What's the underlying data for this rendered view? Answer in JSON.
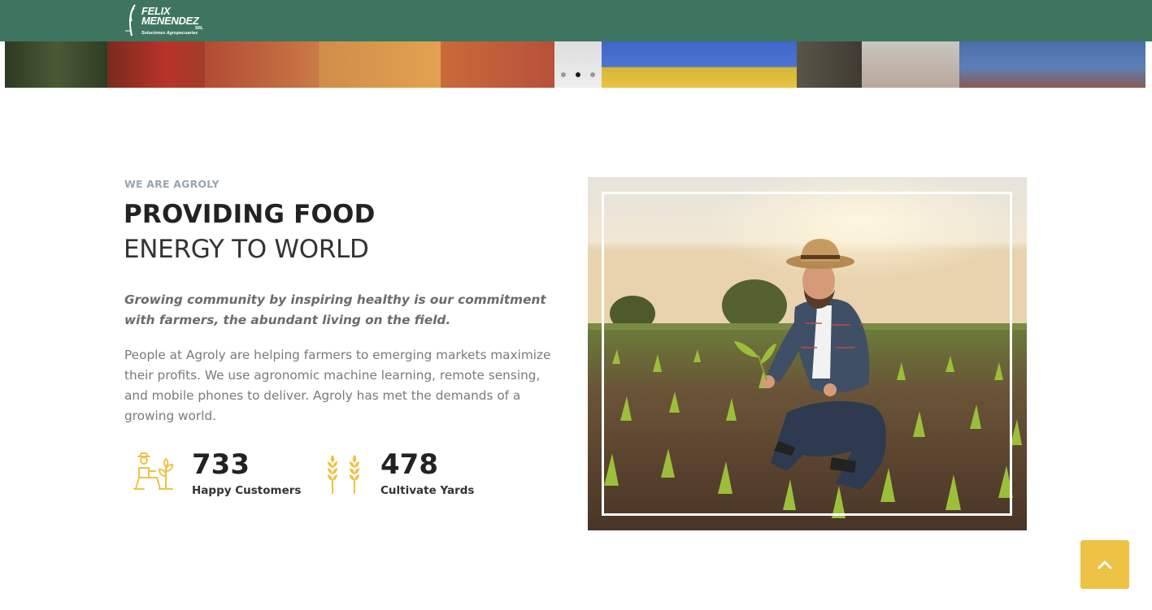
{
  "header": {
    "logo": {
      "line1": "FELIX",
      "line2": "MENENDEZ",
      "suffix": "SRL",
      "tagline": "Soluciones Agropecuarias"
    },
    "background_color": "#3d7560"
  },
  "hero": {
    "slider_dots": 3,
    "active_dot": 2
  },
  "about": {
    "eyebrow": "WE ARE AGROLY",
    "title_bold": "PROVIDING FOOD",
    "title_light": "ENERGY TO WORLD",
    "lead": "Growing community by inspiring healthy is our commitment with farmers, the abundant living on the field.",
    "body": "People at Agroly are helping farmers to emerging markets maximize their profits. We use agronomic machine learning, remote sensing, and mobile phones to deliver. Agroly has met the demands of a growing world.",
    "stats": [
      {
        "icon": "farmer-planting-icon",
        "value": "733",
        "label": "Happy Customers"
      },
      {
        "icon": "wheat-icon",
        "value": "478",
        "label": "Cultivate Yards"
      }
    ]
  },
  "photo": {
    "subject": "farmer-in-corn-field-image"
  },
  "back_to_top": {
    "icon": "chevron-up-icon",
    "color": "#eec244"
  },
  "colors": {
    "accent": "#eec244",
    "brand_green": "#3d7560"
  }
}
